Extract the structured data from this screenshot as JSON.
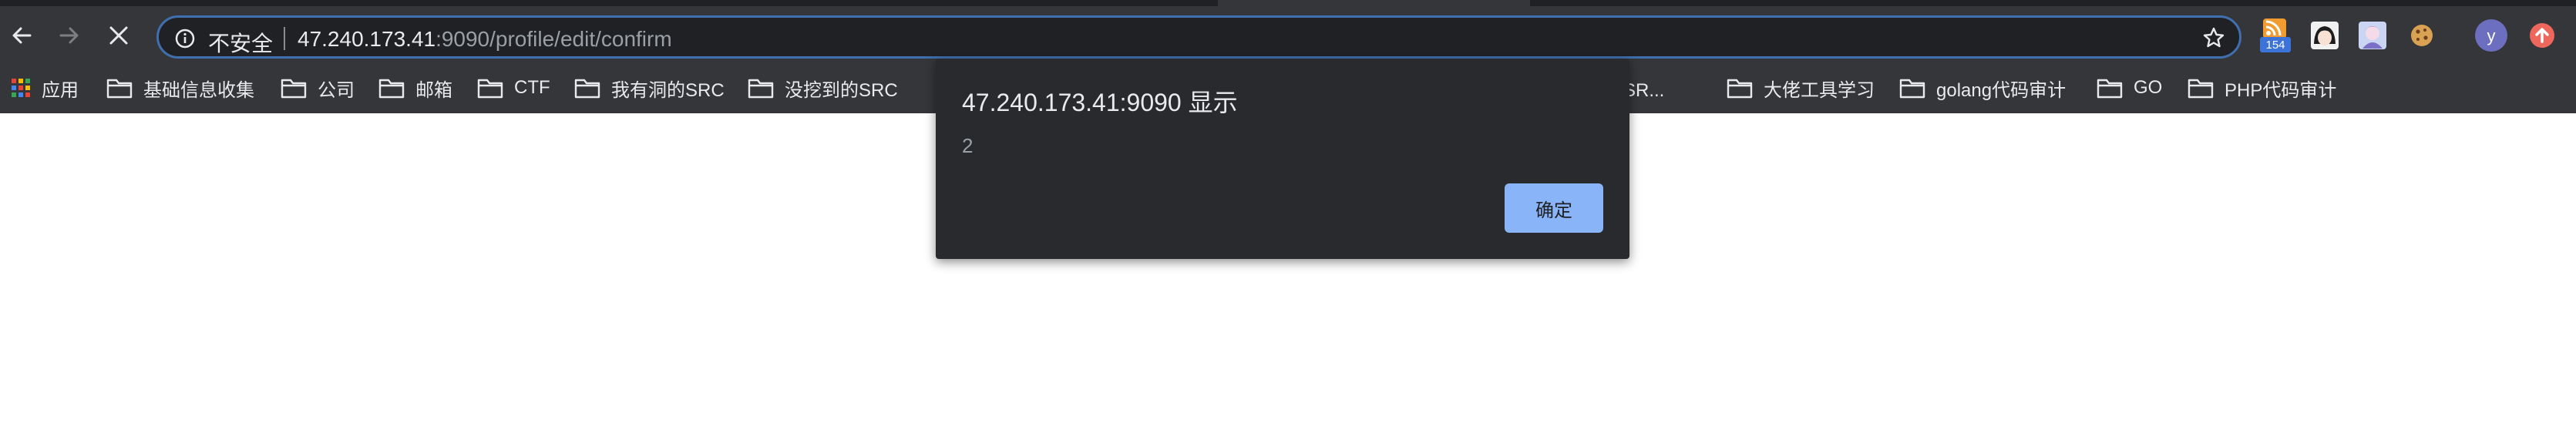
{
  "omnibox": {
    "security_label": "不安全",
    "url_host": "47.240.173.41",
    "url_rest": ":9090/profile/edit/confirm"
  },
  "extensions": {
    "rss_badge": "154",
    "profile_initial": "y"
  },
  "bookmarks": [
    {
      "label": "应用",
      "icon": "apps-grid-icon"
    },
    {
      "label": "基础信息收集",
      "icon": "folder-icon"
    },
    {
      "label": "公司",
      "icon": "folder-icon"
    },
    {
      "label": "邮箱",
      "icon": "folder-icon"
    },
    {
      "label": "CTF",
      "icon": "folder-icon"
    },
    {
      "label": "我有洞的SRC",
      "icon": "folder-icon"
    },
    {
      "label": "没挖到的SRC",
      "icon": "folder-icon"
    },
    {
      "label": "用SSR...",
      "icon": "folder-icon"
    },
    {
      "label": "大佬工具学习",
      "icon": "folder-icon"
    },
    {
      "label": "golang代码审计",
      "icon": "folder-icon"
    },
    {
      "label": "GO",
      "icon": "folder-icon"
    },
    {
      "label": "PHP代码审计",
      "icon": "folder-icon"
    }
  ],
  "dialog": {
    "title": "47.240.173.41:9090 显示",
    "message": "2",
    "ok_label": "确定"
  },
  "colors": {
    "toolbar_bg": "#35363a",
    "omnibox_bg": "#202124",
    "omnibox_focus": "#3f6fae",
    "dialog_bg": "#292a2d",
    "button_accent": "#8ab4f8",
    "page_bg": "#ffffff"
  }
}
